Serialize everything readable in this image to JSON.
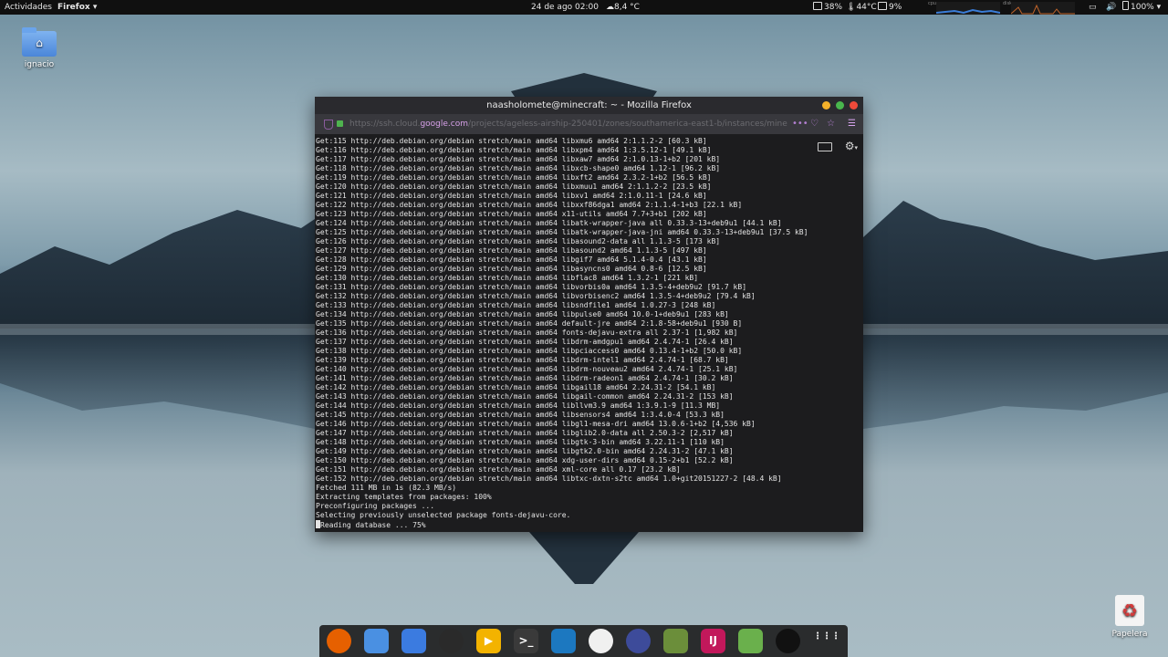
{
  "topbar": {
    "activities": "Actividades",
    "app_menu": "Firefox",
    "datetime": "24 de ago  02:00",
    "weather": "8,4 °C",
    "battery_pct": "38%",
    "temp": "44°C",
    "cpu_pct": "9%",
    "volume_battery": "100%",
    "graph_labels": [
      "cpu",
      "disk"
    ]
  },
  "desktop": {
    "home_label": "ignacio",
    "trash_label": "Papelera"
  },
  "window": {
    "title": "naasholomete@minecraft: ~ - Mozilla Firefox",
    "url_prefix": "https://ssh.cloud.",
    "url_host": "google.com",
    "url_rest": "/projects/ageless-airship-250401/zones/southamerica-east1-b/instances/minec"
  },
  "terminal": {
    "lines": [
      "Get:115 http://deb.debian.org/debian stretch/main amd64 libxmu6 amd64 2:1.1.2-2 [60.3 kB]",
      "Get:116 http://deb.debian.org/debian stretch/main amd64 libxpm4 amd64 1:3.5.12-1 [49.1 kB]",
      "Get:117 http://deb.debian.org/debian stretch/main amd64 libxaw7 amd64 2:1.0.13-1+b2 [201 kB]",
      "Get:118 http://deb.debian.org/debian stretch/main amd64 libxcb-shape0 amd64 1.12-1 [96.2 kB]",
      "Get:119 http://deb.debian.org/debian stretch/main amd64 libxft2 amd64 2.3.2-1+b2 [56.5 kB]",
      "Get:120 http://deb.debian.org/debian stretch/main amd64 libxmuu1 amd64 2:1.1.2-2 [23.5 kB]",
      "Get:121 http://deb.debian.org/debian stretch/main amd64 libxv1 amd64 2:1.0.11-1 [24.6 kB]",
      "Get:122 http://deb.debian.org/debian stretch/main amd64 libxxf86dga1 amd64 2:1.1.4-1+b3 [22.1 kB]",
      "Get:123 http://deb.debian.org/debian stretch/main amd64 x11-utils amd64 7.7+3+b1 [202 kB]",
      "Get:124 http://deb.debian.org/debian stretch/main amd64 libatk-wrapper-java all 0.33.3-13+deb9u1 [44.1 kB]",
      "Get:125 http://deb.debian.org/debian stretch/main amd64 libatk-wrapper-java-jni amd64 0.33.3-13+deb9u1 [37.5 kB]",
      "Get:126 http://deb.debian.org/debian stretch/main amd64 libasound2-data all 1.1.3-5 [173 kB]",
      "Get:127 http://deb.debian.org/debian stretch/main amd64 libasound2 amd64 1.1.3-5 [497 kB]",
      "Get:128 http://deb.debian.org/debian stretch/main amd64 libgif7 amd64 5.1.4-0.4 [43.1 kB]",
      "Get:129 http://deb.debian.org/debian stretch/main amd64 libasyncns0 amd64 0.8-6 [12.5 kB]",
      "Get:130 http://deb.debian.org/debian stretch/main amd64 libflac8 amd64 1.3.2-1 [221 kB]",
      "Get:131 http://deb.debian.org/debian stretch/main amd64 libvorbis0a amd64 1.3.5-4+deb9u2 [91.7 kB]",
      "Get:132 http://deb.debian.org/debian stretch/main amd64 libvorbisenc2 amd64 1.3.5-4+deb9u2 [79.4 kB]",
      "Get:133 http://deb.debian.org/debian stretch/main amd64 libsndfile1 amd64 1.0.27-3 [248 kB]",
      "Get:134 http://deb.debian.org/debian stretch/main amd64 libpulse0 amd64 10.0-1+deb9u1 [283 kB]",
      "Get:135 http://deb.debian.org/debian stretch/main amd64 default-jre amd64 2:1.8-58+deb9u1 [930 B]",
      "Get:136 http://deb.debian.org/debian stretch/main amd64 fonts-dejavu-extra all 2.37-1 [1,982 kB]",
      "Get:137 http://deb.debian.org/debian stretch/main amd64 libdrm-amdgpu1 amd64 2.4.74-1 [26.4 kB]",
      "Get:138 http://deb.debian.org/debian stretch/main amd64 libpciaccess0 amd64 0.13.4-1+b2 [50.0 kB]",
      "Get:139 http://deb.debian.org/debian stretch/main amd64 libdrm-intel1 amd64 2.4.74-1 [68.7 kB]",
      "Get:140 http://deb.debian.org/debian stretch/main amd64 libdrm-nouveau2 amd64 2.4.74-1 [25.1 kB]",
      "Get:141 http://deb.debian.org/debian stretch/main amd64 libdrm-radeon1 amd64 2.4.74-1 [30.2 kB]",
      "Get:142 http://deb.debian.org/debian stretch/main amd64 libgail18 amd64 2.24.31-2 [54.1 kB]",
      "Get:143 http://deb.debian.org/debian stretch/main amd64 libgail-common amd64 2.24.31-2 [153 kB]",
      "Get:144 http://deb.debian.org/debian stretch/main amd64 libllvm3.9 amd64 1:3.9.1-9 [11.3 MB]",
      "Get:145 http://deb.debian.org/debian stretch/main amd64 libsensors4 amd64 1:3.4.0-4 [53.3 kB]",
      "Get:146 http://deb.debian.org/debian stretch/main amd64 libgl1-mesa-dri amd64 13.0.6-1+b2 [4,536 kB]",
      "Get:147 http://deb.debian.org/debian stretch/main amd64 libglib2.0-data all 2.50.3-2 [2,517 kB]",
      "Get:148 http://deb.debian.org/debian stretch/main amd64 libgtk-3-bin amd64 3.22.11-1 [110 kB]",
      "Get:149 http://deb.debian.org/debian stretch/main amd64 libgtk2.0-bin amd64 2.24.31-2 [47.1 kB]",
      "Get:150 http://deb.debian.org/debian stretch/main amd64 xdg-user-dirs amd64 0.15-2+b1 [52.2 kB]",
      "Get:151 http://deb.debian.org/debian stretch/main amd64 xml-core all 0.17 [23.2 kB]",
      "Get:152 http://deb.debian.org/debian stretch/main amd64 libtxc-dxtn-s2tc amd64 1.0+git20151227-2 [48.4 kB]",
      "Fetched 111 MB in 1s (82.3 MB/s)",
      "Extracting templates from packages: 100%",
      "Preconfiguring packages ...",
      "Selecting previously unselected package fonts-dejavu-core."
    ],
    "prompt_line": "Reading database ... 75%"
  },
  "dock": {
    "apps": [
      {
        "name": "firefox-icon",
        "color": "#e66000",
        "glyph": ""
      },
      {
        "name": "files-icon",
        "color": "#4a90e2",
        "glyph": ""
      },
      {
        "name": "store-icon",
        "color": "#3b7be0",
        "glyph": ""
      },
      {
        "name": "gitkraken-icon",
        "color": "#2a2a2a",
        "glyph": ""
      },
      {
        "name": "video-player-icon",
        "color": "#f3b300",
        "glyph": "▶"
      },
      {
        "name": "terminal-icon",
        "color": "#3a3a3a",
        "glyph": ">_"
      },
      {
        "name": "vscode-icon",
        "color": "#1c78c0",
        "glyph": ""
      },
      {
        "name": "virtualbox-icon",
        "color": "#f0f0f0",
        "glyph": ""
      },
      {
        "name": "monitor-icon",
        "color": "#3d4b9a",
        "glyph": ""
      },
      {
        "name": "minecraft-icon",
        "color": "#6b8e3a",
        "glyph": ""
      },
      {
        "name": "intellij-icon",
        "color": "#c2185b",
        "glyph": "IJ"
      },
      {
        "name": "android-studio-icon",
        "color": "#6ab04c",
        "glyph": ""
      },
      {
        "name": "obs-icon",
        "color": "#111111",
        "glyph": ""
      },
      {
        "name": "app-grid-icon",
        "color": "transparent",
        "glyph": "⋮⋮⋮"
      }
    ]
  }
}
